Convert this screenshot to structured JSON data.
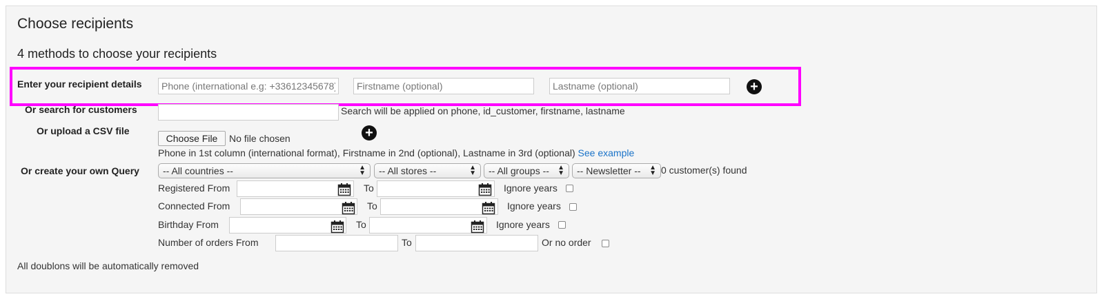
{
  "title": "Choose recipients",
  "subtitle": "4 methods to choose your recipients",
  "recipient": {
    "label": "Enter your recipient details",
    "phone_placeholder": "Phone (international e.g: +33612345678)",
    "firstname_placeholder": "Firstname (optional)",
    "lastname_placeholder": "Lastname (optional)"
  },
  "search": {
    "label": "Or search for customers",
    "hint": "Search will be applied on phone, id_customer, firstname, lastname"
  },
  "csv": {
    "label": "Or upload a CSV file",
    "button": "Choose File",
    "status": "No file chosen",
    "hint": "Phone in 1st column (international format), Firstname in 2nd (optional), Lastname in 3rd (optional)",
    "link": "See example"
  },
  "query": {
    "label": "Or create your own Query",
    "countries": "-- All countries --",
    "stores": "-- All stores --",
    "groups": "-- All groups --",
    "newsletter": "-- Newsletter --",
    "found": "0 customer(s) found",
    "registered_from": "Registered From",
    "connected_from": "Connected From",
    "birthday_from": "Birthday From",
    "orders_from": "Number of orders From",
    "to": "To",
    "ignore_years": "Ignore years",
    "no_order": "Or no order"
  },
  "footer": "All doublons will be automatically removed",
  "colors": {
    "highlight": "#ff00ff",
    "link": "#1a73c8"
  }
}
